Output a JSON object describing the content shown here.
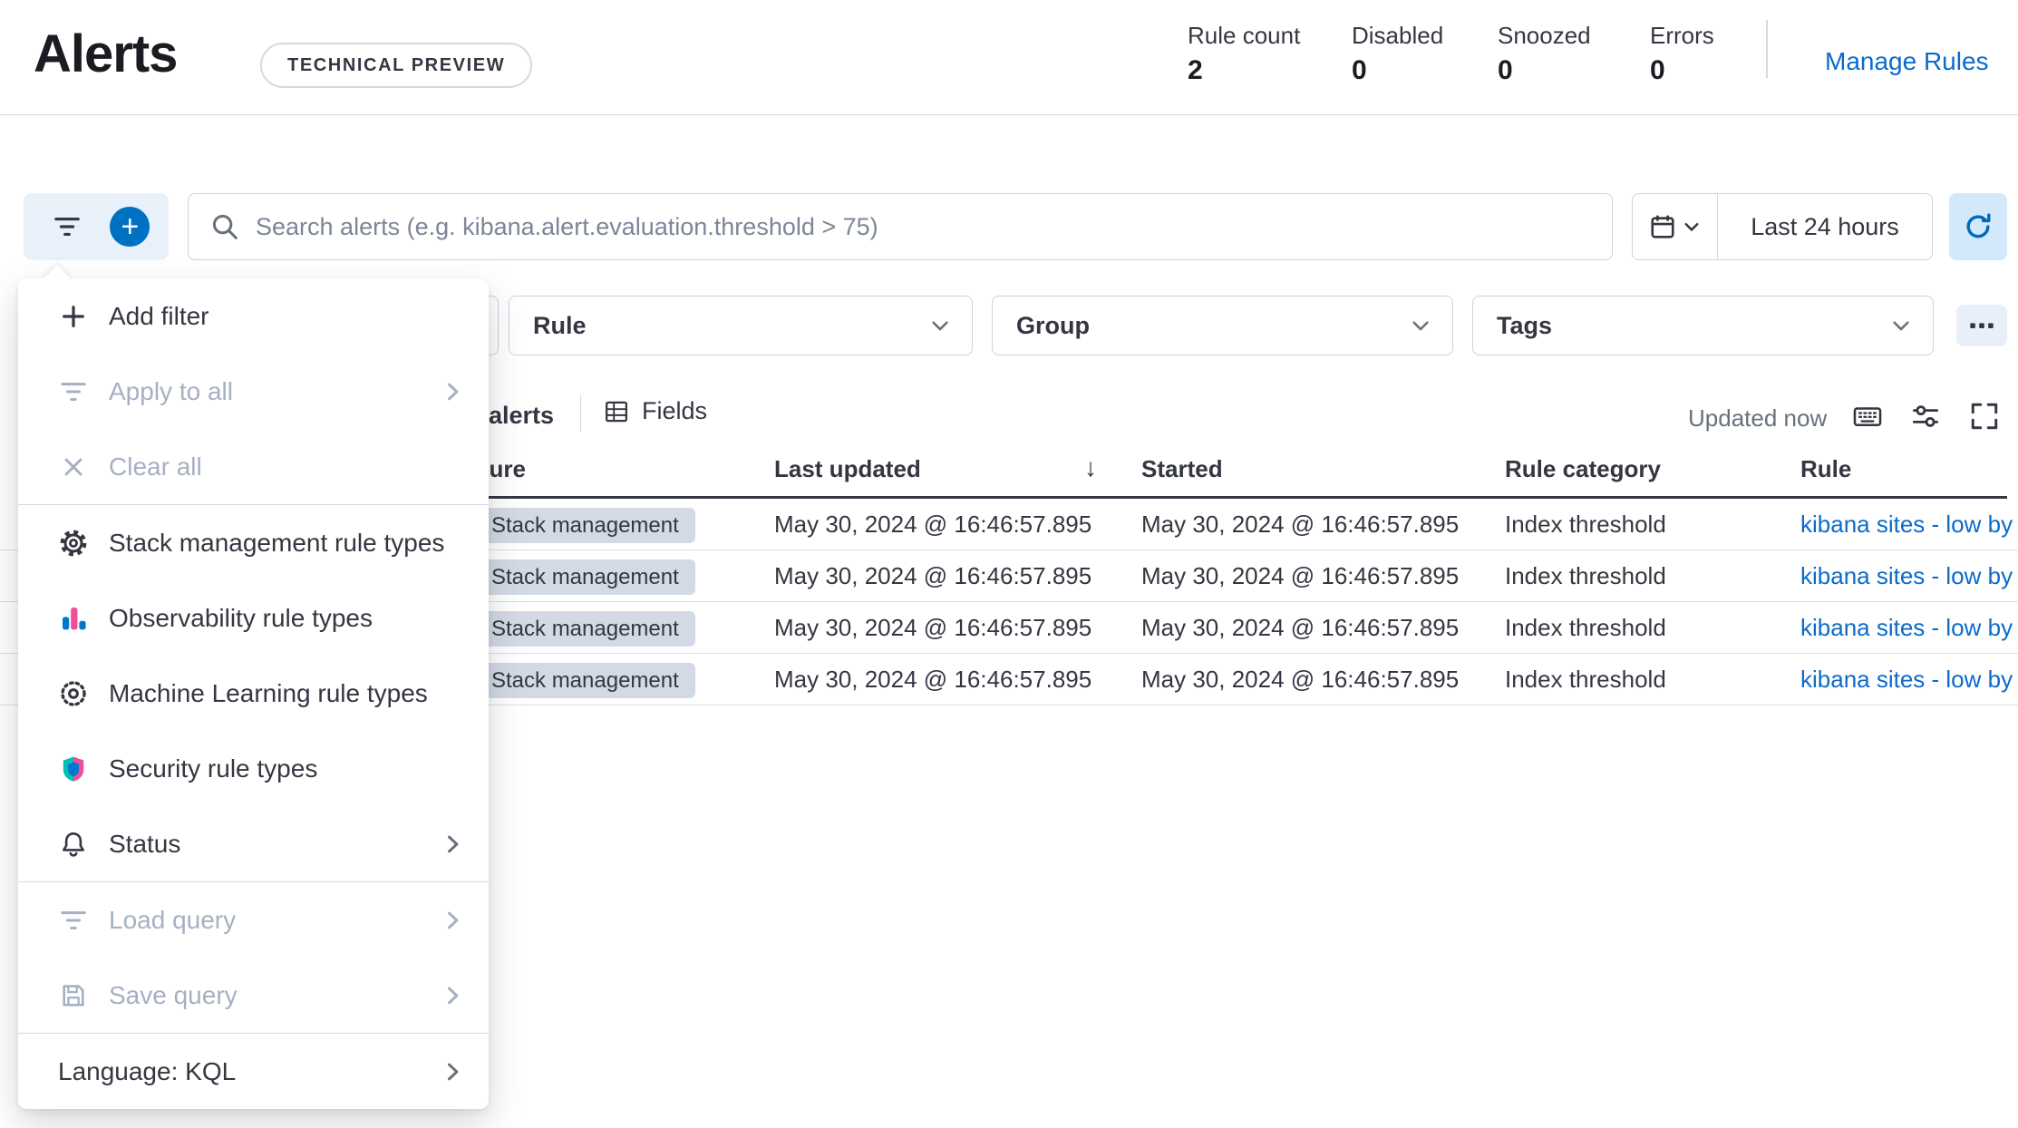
{
  "header": {
    "title": "Alerts",
    "tech_preview_badge": "TECHNICAL PREVIEW",
    "stats": [
      {
        "label": "Rule count",
        "value": "2"
      },
      {
        "label": "Disabled",
        "value": "0"
      },
      {
        "label": "Snoozed",
        "value": "0"
      },
      {
        "label": "Errors",
        "value": "0"
      }
    ],
    "manage_rules_link": "Manage Rules"
  },
  "search": {
    "placeholder": "Search alerts (e.g. kibana.alert.evaluation.threshold > 75)"
  },
  "time_picker": {
    "range": "Last 24 hours"
  },
  "filter_bar": {
    "rule_label": "Rule",
    "group_label": "Group",
    "tags_label": "Tags"
  },
  "filter_menu": {
    "sections": [
      {
        "items": [
          {
            "label": "Add filter"
          },
          {
            "label": "Apply to all"
          },
          {
            "label": "Clear all"
          }
        ]
      },
      {
        "items": [
          {
            "label": "Stack management rule types"
          },
          {
            "label": "Observability rule types"
          },
          {
            "label": "Machine Learning rule types"
          },
          {
            "label": "Security rule types"
          },
          {
            "label": "Status"
          }
        ]
      },
      {
        "items": [
          {
            "label": "Load query"
          },
          {
            "label": "Save query"
          }
        ]
      },
      {
        "items": [
          {
            "label": "Language: KQL"
          }
        ]
      }
    ]
  },
  "grid_toolbar": {
    "alerts_label": "alerts",
    "fields_button": "Fields",
    "updated_status": "Updated now"
  },
  "table": {
    "columns": {
      "feature": "Feature",
      "last_updated": "Last updated",
      "started": "Started",
      "rule_category": "Rule category",
      "rule": "Rule"
    },
    "sort_arrow": "↓",
    "rows": [
      {
        "feature": "Stack management",
        "last_updated": "May 30, 2024 @ 16:46:57.895",
        "started": "May 30, 2024 @ 16:46:57.895",
        "rule_category": "Index threshold",
        "rule": "kibana sites - low by"
      },
      {
        "feature": "Stack management",
        "last_updated": "May 30, 2024 @ 16:46:57.895",
        "started": "May 30, 2024 @ 16:46:57.895",
        "rule_category": "Index threshold",
        "rule": "kibana sites - low by"
      },
      {
        "feature": "Stack management",
        "last_updated": "May 30, 2024 @ 16:46:57.895",
        "started": "May 30, 2024 @ 16:46:57.895",
        "rule_category": "Index threshold",
        "rule": "kibana sites - low by"
      },
      {
        "feature": "Stack management",
        "last_updated": "May 30, 2024 @ 16:46:57.895",
        "started": "May 30, 2024 @ 16:46:57.895",
        "rule_category": "Index threshold",
        "rule": "kibana sites - low by"
      }
    ]
  }
}
